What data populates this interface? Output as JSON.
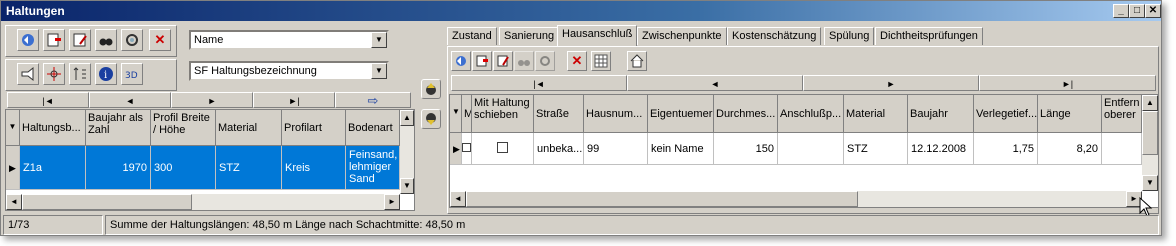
{
  "window": {
    "title": "Haltungen",
    "buttons": [
      "_",
      "□",
      "✕"
    ]
  },
  "left": {
    "combo_field": "Name",
    "combo_label": "SF Haltungsbezeichnung",
    "nav": [
      "|◄",
      "◄",
      "►",
      "►|",
      "⇨"
    ],
    "columns": [
      "Haltungsb...",
      "Baujahr als Zahl",
      "Profil Breite / Höhe",
      "Material",
      "Profilart",
      "Bodenart"
    ],
    "rows": [
      {
        "haltung": "Z1a",
        "baujahr": "1970",
        "profil": "300",
        "material": "STZ",
        "profilart": "Kreis",
        "bodenart": "Feinsand, lehmiger Sand"
      }
    ]
  },
  "right": {
    "tabs": [
      "Zustand",
      "Sanierung",
      "Hausanschluß",
      "Zwischenpunkte",
      "Kostenschätzung",
      "Spülung",
      "Dichtheitsprüfungen"
    ],
    "active_tab": "Hausanschluß",
    "nav": [
      "|◄",
      "◄",
      "►",
      "►|"
    ],
    "columns": [
      "M",
      "Mit Haltung schieben",
      "Straße",
      "Hausnum...",
      "Eigentuemer",
      "Durchmes...",
      "Anschlußp...",
      "Material",
      "Baujahr",
      "Verlegetief...",
      "Länge",
      "Entfern oberer"
    ],
    "rows": [
      {
        "strasse": "unbeka...",
        "hausnummer": "99",
        "eigentuemer": "kein Name",
        "durchmesser": "150",
        "anschluss": "",
        "material": "STZ",
        "baujahr": "12.12.2008",
        "verlegetiefe": "1,75",
        "laenge": "8,20"
      }
    ]
  },
  "status": {
    "record": "1/73",
    "summary": "Summe der Haltungslängen: 48,50 m  Länge nach Schachtmitte: 48,50 m"
  },
  "colors": {
    "selection": "#0078d7",
    "titlebar": "#0a246a",
    "face": "#d4d0c8"
  }
}
